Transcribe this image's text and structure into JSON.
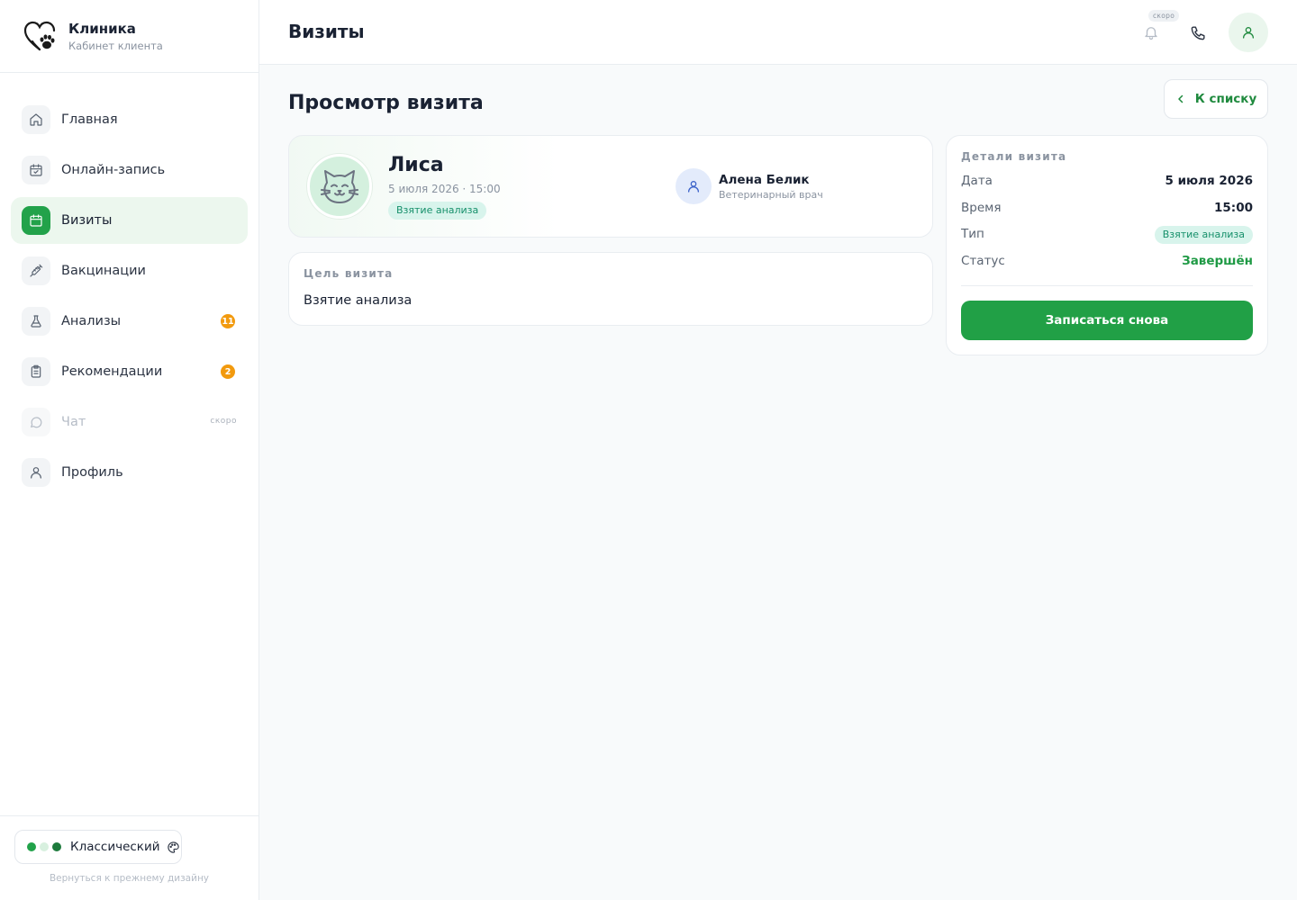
{
  "brand": {
    "title": "Клиника",
    "subtitle": "Кабинет клиента"
  },
  "sidebar": {
    "items": [
      {
        "label": "Главная",
        "icon": "home-icon"
      },
      {
        "label": "Онлайн-запись",
        "icon": "calendar-check-icon"
      },
      {
        "label": "Визиты",
        "icon": "calendar-icon",
        "active": true
      },
      {
        "label": "Вакцинации",
        "icon": "syringe-icon"
      },
      {
        "label": "Анализы",
        "icon": "flask-icon",
        "badge": "11"
      },
      {
        "label": "Рекомендации",
        "icon": "clipboard-icon",
        "badge": "2"
      },
      {
        "label": "Чат",
        "icon": "chat-icon",
        "soon": "скоро",
        "disabled": true
      },
      {
        "label": "Профиль",
        "icon": "user-icon"
      }
    ],
    "footer": {
      "theme_label": "Классический",
      "theme_colors": [
        "#22a24a",
        "#d8f0df",
        "#1d7a3c"
      ],
      "back_link": "Вернуться к прежнему дизайну"
    }
  },
  "topbar": {
    "title": "Визиты",
    "notifications_soon": "скоро"
  },
  "page": {
    "title": "Просмотр визита",
    "back_button": "К списку"
  },
  "pet": {
    "name": "Лиса",
    "datetime": "5 июля 2026 · 15:00",
    "tag": "Взятие анализа"
  },
  "doctor": {
    "name": "Алена Белик",
    "role": "Ветеринарный врач"
  },
  "purpose": {
    "label": "Цель визита",
    "text": "Взятие анализа"
  },
  "details": {
    "label": "Детали визита",
    "date_label": "Дата",
    "date": "5 июля 2026",
    "time_label": "Время",
    "time": "15:00",
    "type_label": "Тип",
    "type": "Взятие анализа",
    "status_label": "Статус",
    "status": "Завершён",
    "rebook_button": "Записаться снова"
  },
  "colors": {
    "accent": "#22a24a",
    "accent_dark": "#1f8a3e",
    "tag_bg": "#d8f4ec",
    "tag_text": "#17906b",
    "badge": "#f29a0e"
  }
}
